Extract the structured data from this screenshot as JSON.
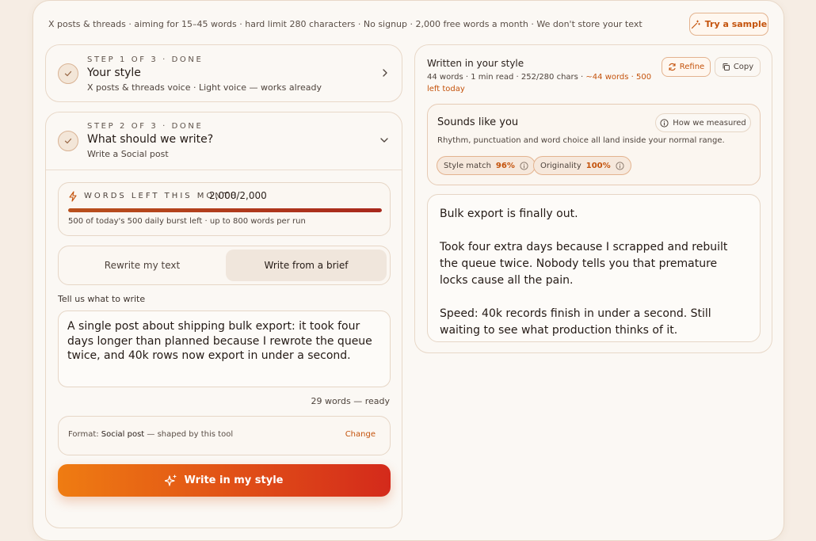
{
  "header": {
    "tagline": "X posts & threads · aiming for 15–45 words · hard limit 280 characters · No signup · 2,000 free words a month · We don't store your text",
    "sample_button": "Try a sample"
  },
  "step1": {
    "kicker": "STEP 1 OF 3 · DONE",
    "title": "Your style",
    "subtitle": "X posts & threads voice · Light voice — works already"
  },
  "step2": {
    "kicker": "STEP 2 OF 3 · DONE",
    "title": "What should we write?",
    "subtitle": "Write a Social post"
  },
  "quota": {
    "label": "WORDS LEFT THIS MONTH",
    "count": "2,000/2,000",
    "fill_fraction": 1.0,
    "note": "500 of today's 500 daily burst left · up to 800 words per run"
  },
  "mode": {
    "options": [
      "Rewrite my text",
      "Write from a brief"
    ],
    "selected": "Write from a brief"
  },
  "brief": {
    "label": "Tell us what to write",
    "value": "A single post about shipping bulk export: it took four days longer than planned because I rewrote the queue twice, and 40k rows now export in under a second.",
    "word_status": "29 words — ready"
  },
  "format": {
    "prefix": "Format:",
    "name": "Social post",
    "suffix": "— shaped by this tool",
    "change": "Change"
  },
  "cta": {
    "label": "Write in my style"
  },
  "result": {
    "title": "Written in your style",
    "meta_main": "44 words · 1 min read · 252/280 chars ·",
    "meta_warn": "~44 words · 500 left today",
    "refine": "Refine",
    "copy": "Copy",
    "sounds_title": "Sounds like you",
    "how_measured": "How we measured",
    "sounds_desc": "Rhythm, punctuation and word choice all land inside your normal range.",
    "style_match_label": "Style match",
    "style_match_value": "96%",
    "originality_label": "Originality",
    "originality_value": "100%",
    "paragraphs": [
      "Bulk export is finally out.",
      "Took four extra days because I scrapped and rebuilt the queue twice. Nobody tells you that premature locks cause all the pain.",
      "Speed: 40k records finish in under a second. Still waiting to see what production thinks of it."
    ]
  },
  "colors": {
    "accent": "#c4530c",
    "cta_start": "#ef7c12",
    "cta_end": "#d42a1b",
    "page_bg": "#f6ede4"
  }
}
